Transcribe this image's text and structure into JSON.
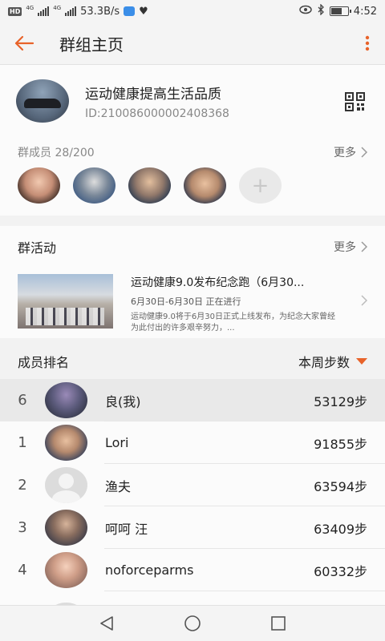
{
  "status_bar": {
    "hd": "HD",
    "net1": "4G",
    "net2": "4G",
    "speed": "53.3B/s",
    "battery_level": 0.6,
    "time": "4:52"
  },
  "app_bar": {
    "title": "群组主页"
  },
  "group": {
    "name": "运动健康提高生活品质",
    "id": "ID:210086000002408368"
  },
  "members": {
    "label": "群成员 28/200",
    "more_label": "更多",
    "add_label": "+"
  },
  "activity": {
    "section_title": "群活动",
    "more_label": "更多",
    "name": "运动健康9.0发布纪念跑（6月30...",
    "date": "6月30日-6月30日 正在进行",
    "description": "运动健康9.0将于6月30日正式上线发布，为纪念大家曾经为此付出的许多艰辛努力，..."
  },
  "ranking": {
    "title": "成员排名",
    "sort_label": "本周步数",
    "rows": [
      {
        "rank": "6",
        "name": "良(我)",
        "steps": "53129步"
      },
      {
        "rank": "1",
        "name": "Lori",
        "steps": "91855步"
      },
      {
        "rank": "2",
        "name": "渔夫",
        "steps": "63594步"
      },
      {
        "rank": "3",
        "name": "呵呵 汪",
        "steps": "63409步"
      },
      {
        "rank": "4",
        "name": "noforceparms",
        "steps": "60332步"
      }
    ]
  },
  "colors": {
    "accent": "#e8632a"
  }
}
